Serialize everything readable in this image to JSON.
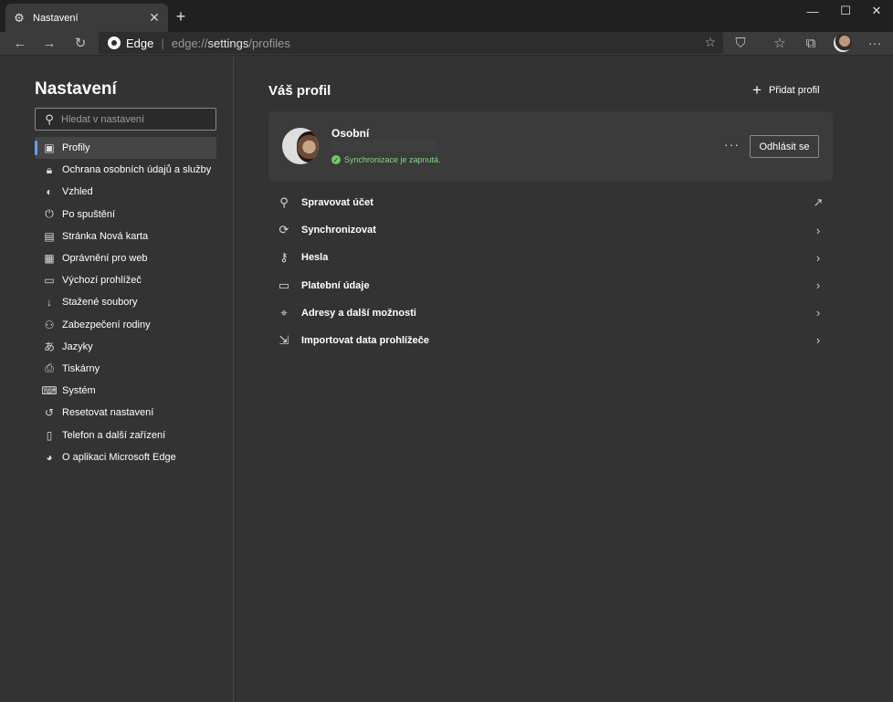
{
  "tab": {
    "title": "Nastavení",
    "icon": "gear-icon"
  },
  "address": {
    "site_name": "Edge",
    "url_prefix": "edge://",
    "url_host": "settings",
    "url_path": "/profiles"
  },
  "sidebar": {
    "title": "Nastavení",
    "search_placeholder": "Hledat v nastavení",
    "items": [
      {
        "label": "Profily",
        "icon": "profile-icon",
        "active": true
      },
      {
        "label": "Ochrana osobních údajů a služby",
        "icon": "lock-icon"
      },
      {
        "label": "Vzhled",
        "icon": "palette-icon"
      },
      {
        "label": "Po spuštění",
        "icon": "power-icon"
      },
      {
        "label": "Stránka Nová karta",
        "icon": "newtab-page-icon"
      },
      {
        "label": "Oprávnění pro web",
        "icon": "site-permissions-icon"
      },
      {
        "label": "Výchozí prohlížeč",
        "icon": "default-browser-icon"
      },
      {
        "label": "Stažené soubory",
        "icon": "download-icon"
      },
      {
        "label": "Zabezpečení rodiny",
        "icon": "family-icon"
      },
      {
        "label": "Jazyky",
        "icon": "languages-icon"
      },
      {
        "label": "Tiskárny",
        "icon": "printer-icon"
      },
      {
        "label": "Systém",
        "icon": "laptop-icon"
      },
      {
        "label": "Resetovat nastavení",
        "icon": "reset-icon"
      },
      {
        "label": "Telefon a další zařízení",
        "icon": "phone-icon"
      },
      {
        "label": "O aplikaci Microsoft Edge",
        "icon": "edge-logo-icon"
      }
    ]
  },
  "main": {
    "title": "Váš profil",
    "add_profile_label": "Přidat profil",
    "profile": {
      "name": "Osobní",
      "sync_status": "Synchronizace je zapnutá.",
      "sign_out_label": "Odhlásit se"
    },
    "rows": [
      {
        "label": "Spravovat účet",
        "icon": "person-icon",
        "trail": "external-link-icon"
      },
      {
        "label": "Synchronizovat",
        "icon": "sync-icon",
        "trail": "chevron-right-icon"
      },
      {
        "label": "Hesla",
        "icon": "key-icon",
        "trail": "chevron-right-icon"
      },
      {
        "label": "Platební údaje",
        "icon": "credit-card-icon",
        "trail": "chevron-right-icon"
      },
      {
        "label": "Adresy a další možnosti",
        "icon": "location-pin-icon",
        "trail": "chevron-right-icon"
      },
      {
        "label": "Importovat data prohlížeče",
        "icon": "import-icon",
        "trail": "chevron-right-icon"
      }
    ]
  },
  "colors": {
    "background": "#333333",
    "card": "#3b3b3b",
    "accent": "#5ea0ef",
    "sync_ok": "#8bd18b"
  }
}
